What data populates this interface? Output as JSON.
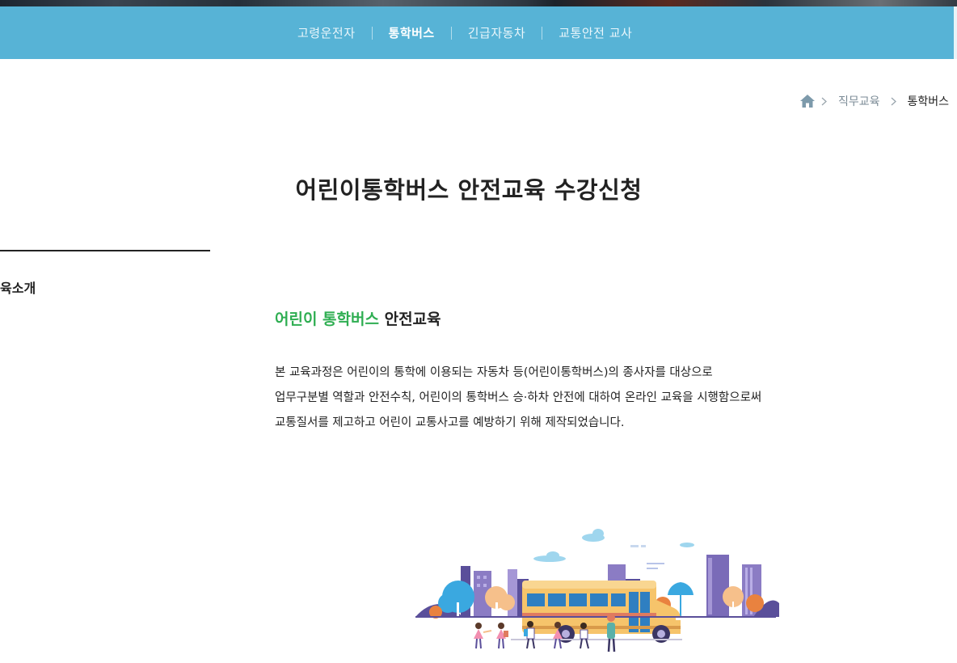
{
  "nav": {
    "items": [
      {
        "label": "고령운전자",
        "active": false
      },
      {
        "label": "통학버스",
        "active": true
      },
      {
        "label": "긴급자동차",
        "active": false
      },
      {
        "label": "교통안전 교사",
        "active": false
      }
    ]
  },
  "breadcrumb": {
    "home_icon": "home-icon",
    "items": [
      "직무교육",
      "통학버스"
    ]
  },
  "page": {
    "title": "어린이통학버스 안전교육 수강신청"
  },
  "sidebar": {
    "item_label": "육소개"
  },
  "section": {
    "heading_highlight": "어린이 통학버스",
    "heading_rest": " 안전교육",
    "lines": [
      "본 교육과정은 어린이의 통학에 이용되는 자동차 등(어린이통학버스)의 종사자를 대상으로",
      "업무구분별 역할과 안전수칙, 어린이의 통학버스 승·하차 안전에 대하여 온라인 교육을 시행함으로써",
      "교통질서를 제고하고 어린이 교통사고를 예방하기 위해 제작되었습니다."
    ]
  },
  "colors": {
    "nav_bg": "#57b3d6",
    "accent_green": "#2fae52",
    "bus_yellow": "#f6c46b"
  }
}
